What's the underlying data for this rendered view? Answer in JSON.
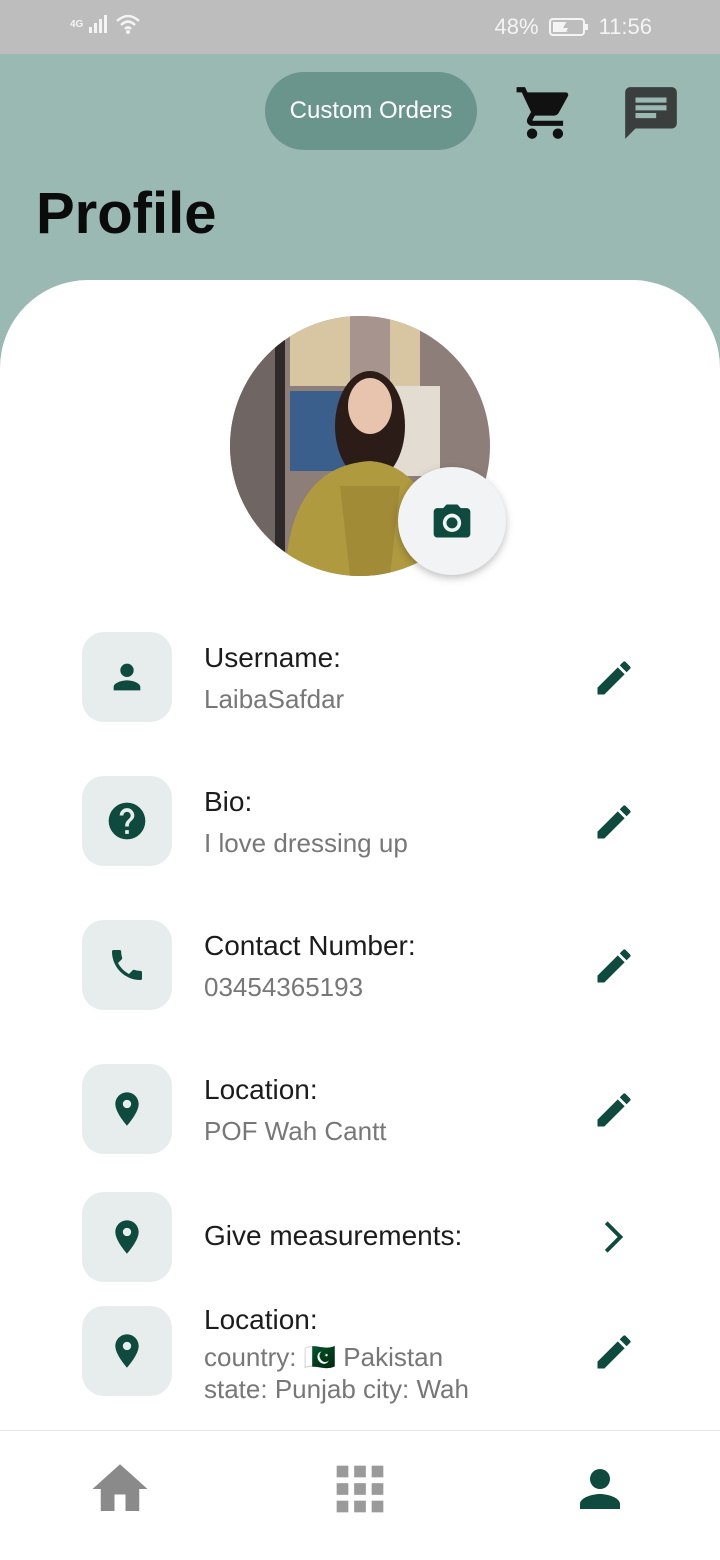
{
  "status_bar": {
    "network": "4G",
    "battery": "48%",
    "time": "11:56"
  },
  "header": {
    "custom_orders_label": "Custom Orders",
    "cart_icon": "cart-icon",
    "chat_icon": "chat-icon",
    "title": "Profile"
  },
  "profile": {
    "camera_icon": "camera-icon"
  },
  "rows": [
    {
      "icon": "person-icon",
      "label": "Username:",
      "value": "LaibaSafdar",
      "action": "edit-icon"
    },
    {
      "icon": "help-icon",
      "label": "Bio:",
      "value": "I love dressing up",
      "action": "edit-icon"
    },
    {
      "icon": "phone-icon",
      "label": "Contact Number:",
      "value": "03454365193",
      "action": "edit-icon"
    },
    {
      "icon": "location-icon",
      "label": "Location:",
      "value": "POF Wah Cantt",
      "action": "edit-icon"
    },
    {
      "icon": "location-icon",
      "label": "Give measurements:",
      "action": "chevron-right-icon"
    },
    {
      "icon": "location-icon",
      "label": "Location:",
      "value_line1": "country: 🇵🇰    Pakistan",
      "value_line2": "state: Punjab city: Wah",
      "action": "edit-icon"
    }
  ],
  "bottom_nav": {
    "items": [
      "home-icon",
      "grid-icon",
      "person-icon"
    ],
    "active": "person-icon"
  },
  "colors": {
    "header_bg": "#9ab9b3",
    "pill_bg": "#6a958d",
    "accent": "#0e4a3e",
    "tile_bg": "#e7ecec"
  }
}
